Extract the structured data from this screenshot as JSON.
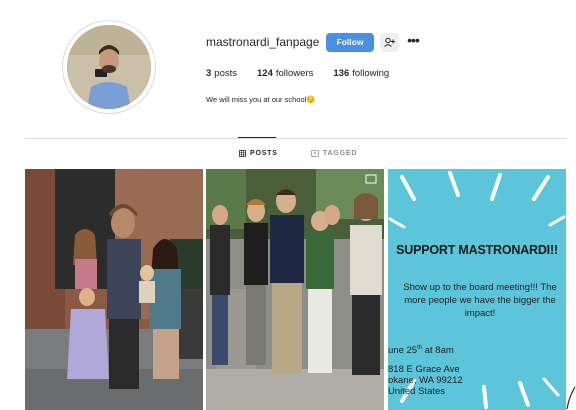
{
  "profile": {
    "username": "mastronardi_fanpage",
    "follow_label": "Follow",
    "more_label": "•••",
    "stats": {
      "posts_count": "3",
      "posts_label": "posts",
      "followers_count": "124",
      "followers_label": "followers",
      "following_count": "136",
      "following_label": "following"
    },
    "bio": "We will miss you at our school😔"
  },
  "tabs": [
    {
      "label": "POSTS",
      "icon": "grid-icon",
      "active": true
    },
    {
      "label": "TAGGED",
      "icon": "tag-icon",
      "active": false
    }
  ],
  "posts": {
    "post3": {
      "title": "SUPPORT MASTRONARDI!!",
      "body": "Show up to the board meeting!!! The more people we have the bigger the impact!",
      "date_prefix": "une 25",
      "date_sup": "th",
      "date_suffix": " at 8am",
      "addr_line1": "818 E Grace Ave",
      "addr_line2": "okane, WA  99212",
      "addr_line3": "United States"
    }
  },
  "colors": {
    "accent": "#4a90e2",
    "post3_background": "#5cc5d9"
  }
}
